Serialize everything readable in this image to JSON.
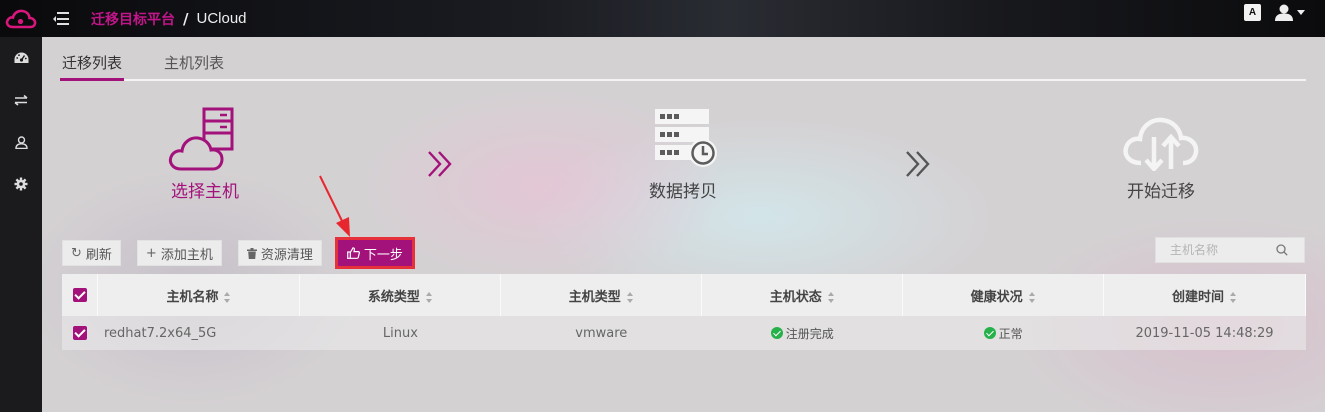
{
  "header": {
    "app_title": "迁移目标平台",
    "separator": "/",
    "platform": "UCloud",
    "lang_icon_text": "A"
  },
  "sidebar": {
    "items": [
      {
        "icon": "dashboard-icon"
      },
      {
        "icon": "transfer-icon"
      },
      {
        "icon": "user-icon"
      },
      {
        "icon": "gear-icon"
      }
    ]
  },
  "tabs": [
    {
      "label": "迁移列表",
      "active": true
    },
    {
      "label": "主机列表",
      "active": false
    }
  ],
  "steps": [
    {
      "label": "选择主机",
      "icon": "cloud-server-icon",
      "active": true
    },
    {
      "label": "数据拷贝",
      "icon": "server-clock-icon",
      "active": false
    },
    {
      "label": "开始迁移",
      "icon": "cloud-transfer-icon",
      "active": false
    }
  ],
  "toolbar": {
    "refresh_label": "刷新",
    "add_host_label": "添加主机",
    "cleanup_label": "资源清理",
    "next_label": "下一步"
  },
  "search": {
    "placeholder": "主机名称"
  },
  "table": {
    "columns": [
      "主机名称",
      "系统类型",
      "主机类型",
      "主机状态",
      "健康状况",
      "创建时间"
    ],
    "rows": [
      {
        "host_name": "redhat7.2x64_5G",
        "os_type": "Linux",
        "host_type": "vmware",
        "host_status": "注册完成",
        "health": "正常",
        "created": "2019-11-05 14:48:29",
        "checked": true
      }
    ]
  },
  "colors": {
    "accent": "#a3117a",
    "highlight_border": "#e6303a",
    "ok": "#26b14a"
  }
}
